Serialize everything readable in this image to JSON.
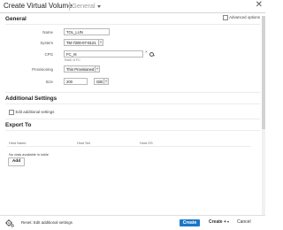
{
  "header": {
    "title": "Create Virtual Volume",
    "view_selector": "General",
    "close_glyph": "✕"
  },
  "general": {
    "heading": "General",
    "advanced_options_label": "Advanced options",
    "name": {
      "label": "Name",
      "value": "TOL_LUN"
    },
    "system": {
      "label": "System",
      "value": "TM-7200-07-8121"
    },
    "cpg": {
      "label": "CPG",
      "value": "FC_r6",
      "hint": "RAID 6 FC"
    },
    "provisioning": {
      "label": "Provisioning",
      "value": "Thin Provisioned"
    },
    "size": {
      "label": "Size",
      "value": "200",
      "unit": "GiB"
    }
  },
  "additional_settings": {
    "heading": "Additional Settings",
    "edit_label": "Edit additional settings"
  },
  "export_to": {
    "heading": "Export To",
    "columns": [
      "Host Name",
      "Host Set",
      "Host OS"
    ],
    "empty_text": "No data available in table",
    "add_label": "Add"
  },
  "footer": {
    "reset_label": "Reset: Edit additional settings",
    "create_label": "Create",
    "create_plus_label": "Create +",
    "cancel_label": "Cancel"
  },
  "colors": {
    "primary_button": "#1a76c9"
  }
}
